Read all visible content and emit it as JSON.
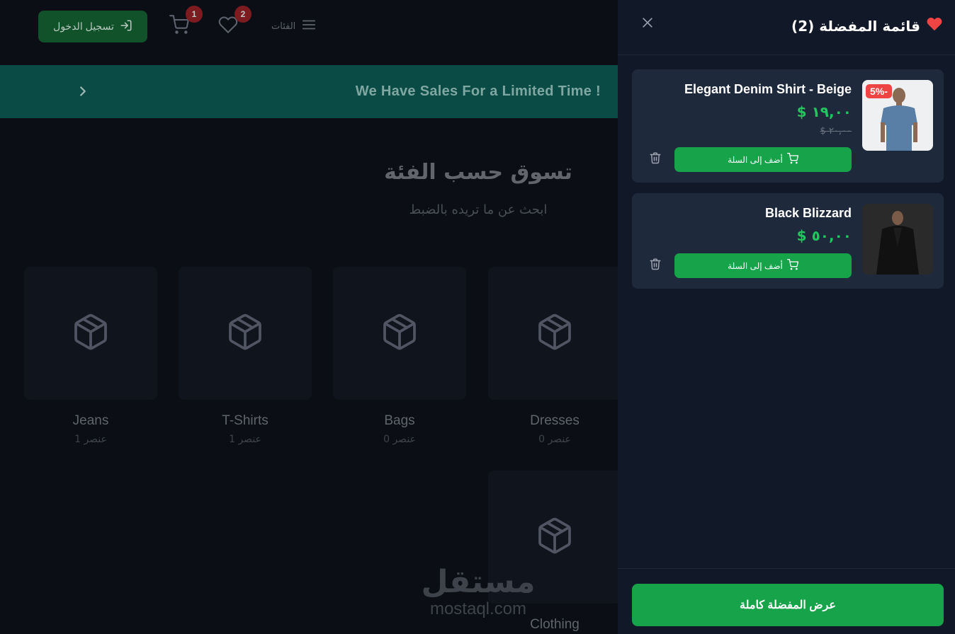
{
  "navbar": {
    "login_label": "تسجيل الدخول",
    "cart_count": "1",
    "wishlist_count": "2",
    "categories_label": "الفئات"
  },
  "banner": {
    "text": "We Have Sales For a Limited Time !"
  },
  "section": {
    "title": "تسوق حسب الفئة",
    "subtitle": "ابحث عن ما تريده بالضبط"
  },
  "categories": [
    {
      "name": "Jeans",
      "count": "عنصر 1"
    },
    {
      "name": "T-Shirts",
      "count": "عنصر 1"
    },
    {
      "name": "Bags",
      "count": "عنصر 0"
    },
    {
      "name": "Dresses",
      "count": "عنصر 0"
    },
    {
      "name": "Clothing",
      "count": ""
    }
  ],
  "watermark": {
    "arabic": "مستقل",
    "latin": "mostaql.com"
  },
  "wishlist": {
    "title": "قائمة المفضلة (2)",
    "items": [
      {
        "name": "Elegant Denim Shirt - Beige",
        "price": "$ ١٩,٠٠",
        "old_price": "$ ٢٠,٠٠",
        "discount": "5%-",
        "add_label": "أضف إلى السلة"
      },
      {
        "name": "Black Blizzard",
        "price": "$ ٥٠,٠٠",
        "add_label": "أضف إلى السلة"
      }
    ],
    "view_all_label": "عرض المفضلة كاملة"
  },
  "colors": {
    "accent_green": "#16a34a",
    "price_green": "#22c55e",
    "discount_red": "#ef4444",
    "panel_bg": "#111827",
    "card_bg": "#1e293b"
  }
}
